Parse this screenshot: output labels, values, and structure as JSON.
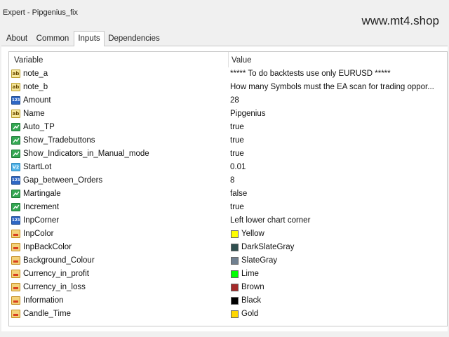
{
  "window": {
    "title": "Expert - Pipgenius_fix"
  },
  "watermark": "www.mt4.shop",
  "tabs": [
    {
      "label": "About"
    },
    {
      "label": "Common"
    },
    {
      "label": "Inputs",
      "active": true
    },
    {
      "label": "Dependencies"
    }
  ],
  "table": {
    "headers": {
      "variable": "Variable",
      "value": "Value"
    },
    "rows": [
      {
        "name": "note_a",
        "value": "***** To do backtests use only EURUSD *****",
        "icon": "string-ab-icon"
      },
      {
        "name": "note_b",
        "value": "How many Symbols must the EA scan for trading oppor...",
        "icon": "string-ab-icon"
      },
      {
        "name": "Amount",
        "value": "28",
        "icon": "integer-123-icon"
      },
      {
        "name": "Name",
        "value": "Pipgenius",
        "icon": "string-ab-icon"
      },
      {
        "name": "Auto_TP",
        "value": "true",
        "icon": "bool-icon"
      },
      {
        "name": "Show_Tradebuttons",
        "value": "true",
        "icon": "bool-icon"
      },
      {
        "name": "Show_Indicators_in_Manual_mode",
        "value": "true",
        "icon": "bool-icon"
      },
      {
        "name": "StartLot",
        "value": "0.01",
        "icon": "double-v2-icon"
      },
      {
        "name": "Gap_between_Orders",
        "value": "8",
        "icon": "integer-123-icon"
      },
      {
        "name": "Martingale",
        "value": "false",
        "icon": "bool-icon"
      },
      {
        "name": "Increment",
        "value": "true",
        "icon": "bool-icon"
      },
      {
        "name": "InpCorner",
        "value": "Left lower chart corner",
        "icon": "integer-123-icon"
      },
      {
        "name": "InpColor",
        "value": "Yellow",
        "icon": "color-icon",
        "swatch": "#ffff00"
      },
      {
        "name": "InpBackColor",
        "value": "DarkSlateGray",
        "icon": "color-icon",
        "swatch": "#2f4f4f"
      },
      {
        "name": "Background_Colour",
        "value": "SlateGray",
        "icon": "color-icon",
        "swatch": "#708090"
      },
      {
        "name": "Currency_in_profit",
        "value": "Lime",
        "icon": "color-icon",
        "swatch": "#00ff00"
      },
      {
        "name": "Currency_in_loss",
        "value": "Brown",
        "icon": "color-icon",
        "swatch": "#a52a2a"
      },
      {
        "name": "Information",
        "value": "Black",
        "icon": "color-icon",
        "swatch": "#000000"
      },
      {
        "name": "Candle_Time",
        "value": "Gold",
        "icon": "color-icon",
        "swatch": "#ffd700"
      }
    ]
  }
}
